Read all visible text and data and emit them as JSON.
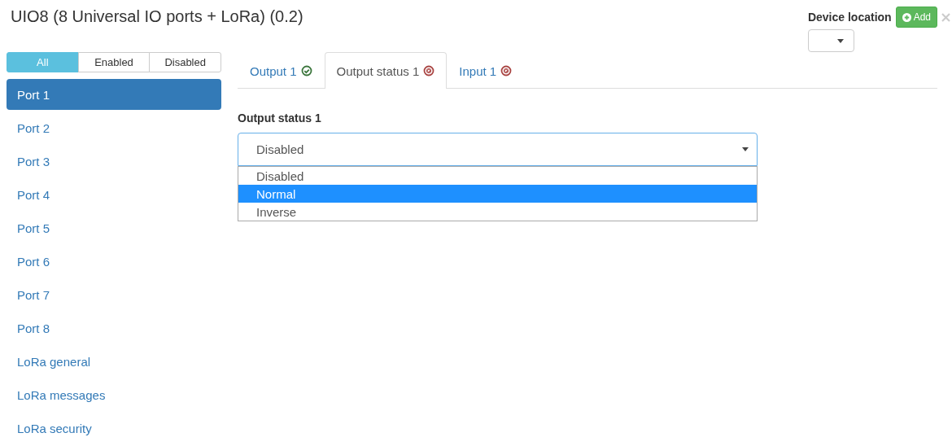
{
  "title": "UIO8 (8 Universal IO ports + LoRa) (0.2)",
  "device_location": {
    "label": "Device location",
    "add_button": "Add"
  },
  "filters": [
    {
      "label": "All",
      "selected": true
    },
    {
      "label": "Enabled",
      "selected": false
    },
    {
      "label": "Disabled",
      "selected": false
    }
  ],
  "sidebar": {
    "items": [
      {
        "label": "Port 1",
        "selected": true
      },
      {
        "label": "Port 2",
        "selected": false
      },
      {
        "label": "Port 3",
        "selected": false
      },
      {
        "label": "Port 4",
        "selected": false
      },
      {
        "label": "Port 5",
        "selected": false
      },
      {
        "label": "Port 6",
        "selected": false
      },
      {
        "label": "Port 7",
        "selected": false
      },
      {
        "label": "Port 8",
        "selected": false
      },
      {
        "label": "LoRa general",
        "selected": false
      },
      {
        "label": "LoRa messages",
        "selected": false
      },
      {
        "label": "LoRa security",
        "selected": false
      }
    ]
  },
  "tabs": [
    {
      "label": "Output 1",
      "valid": true,
      "selected": false
    },
    {
      "label": "Output status 1",
      "valid": false,
      "selected": true
    },
    {
      "label": "Input 1",
      "valid": false,
      "selected": false
    }
  ],
  "field": {
    "label": "Output status 1",
    "value": "Disabled",
    "options": [
      {
        "label": "Disabled",
        "highlighted": false
      },
      {
        "label": "Normal",
        "highlighted": true
      },
      {
        "label": "Inverse",
        "highlighted": false
      }
    ]
  }
}
